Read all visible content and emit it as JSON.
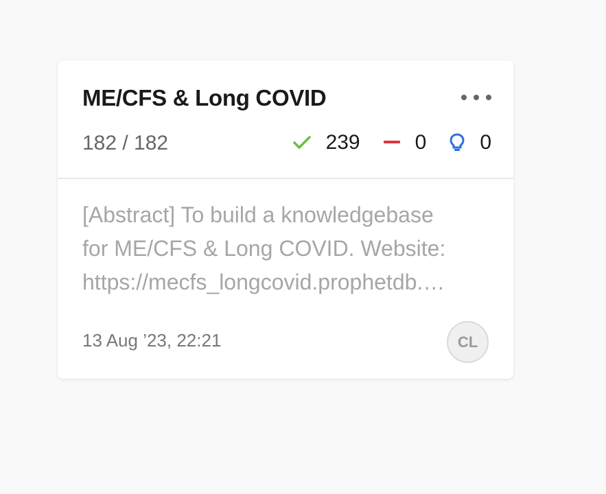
{
  "card": {
    "title": "ME/CFS & Long COVID",
    "count": "182 / 182",
    "stats": {
      "approved": "239",
      "rejected": "0",
      "ideas": "0"
    },
    "abstract_lines": [
      "[Abstract] To build a knowledgebase",
      "for ME/CFS & Long COVID. Website:",
      "https://mecfs_longcovid.prophetdb.…"
    ],
    "date": "13 Aug ’23, 22:21",
    "avatar_initials": "CL"
  },
  "icons": {
    "approved": "check-icon",
    "rejected": "minus-icon",
    "ideas": "lightbulb-icon",
    "menu": "more-horizontal-icon"
  },
  "colors": {
    "check": "#6abf40",
    "minus": "#d9363e",
    "bulb": "#2b6fe0"
  }
}
